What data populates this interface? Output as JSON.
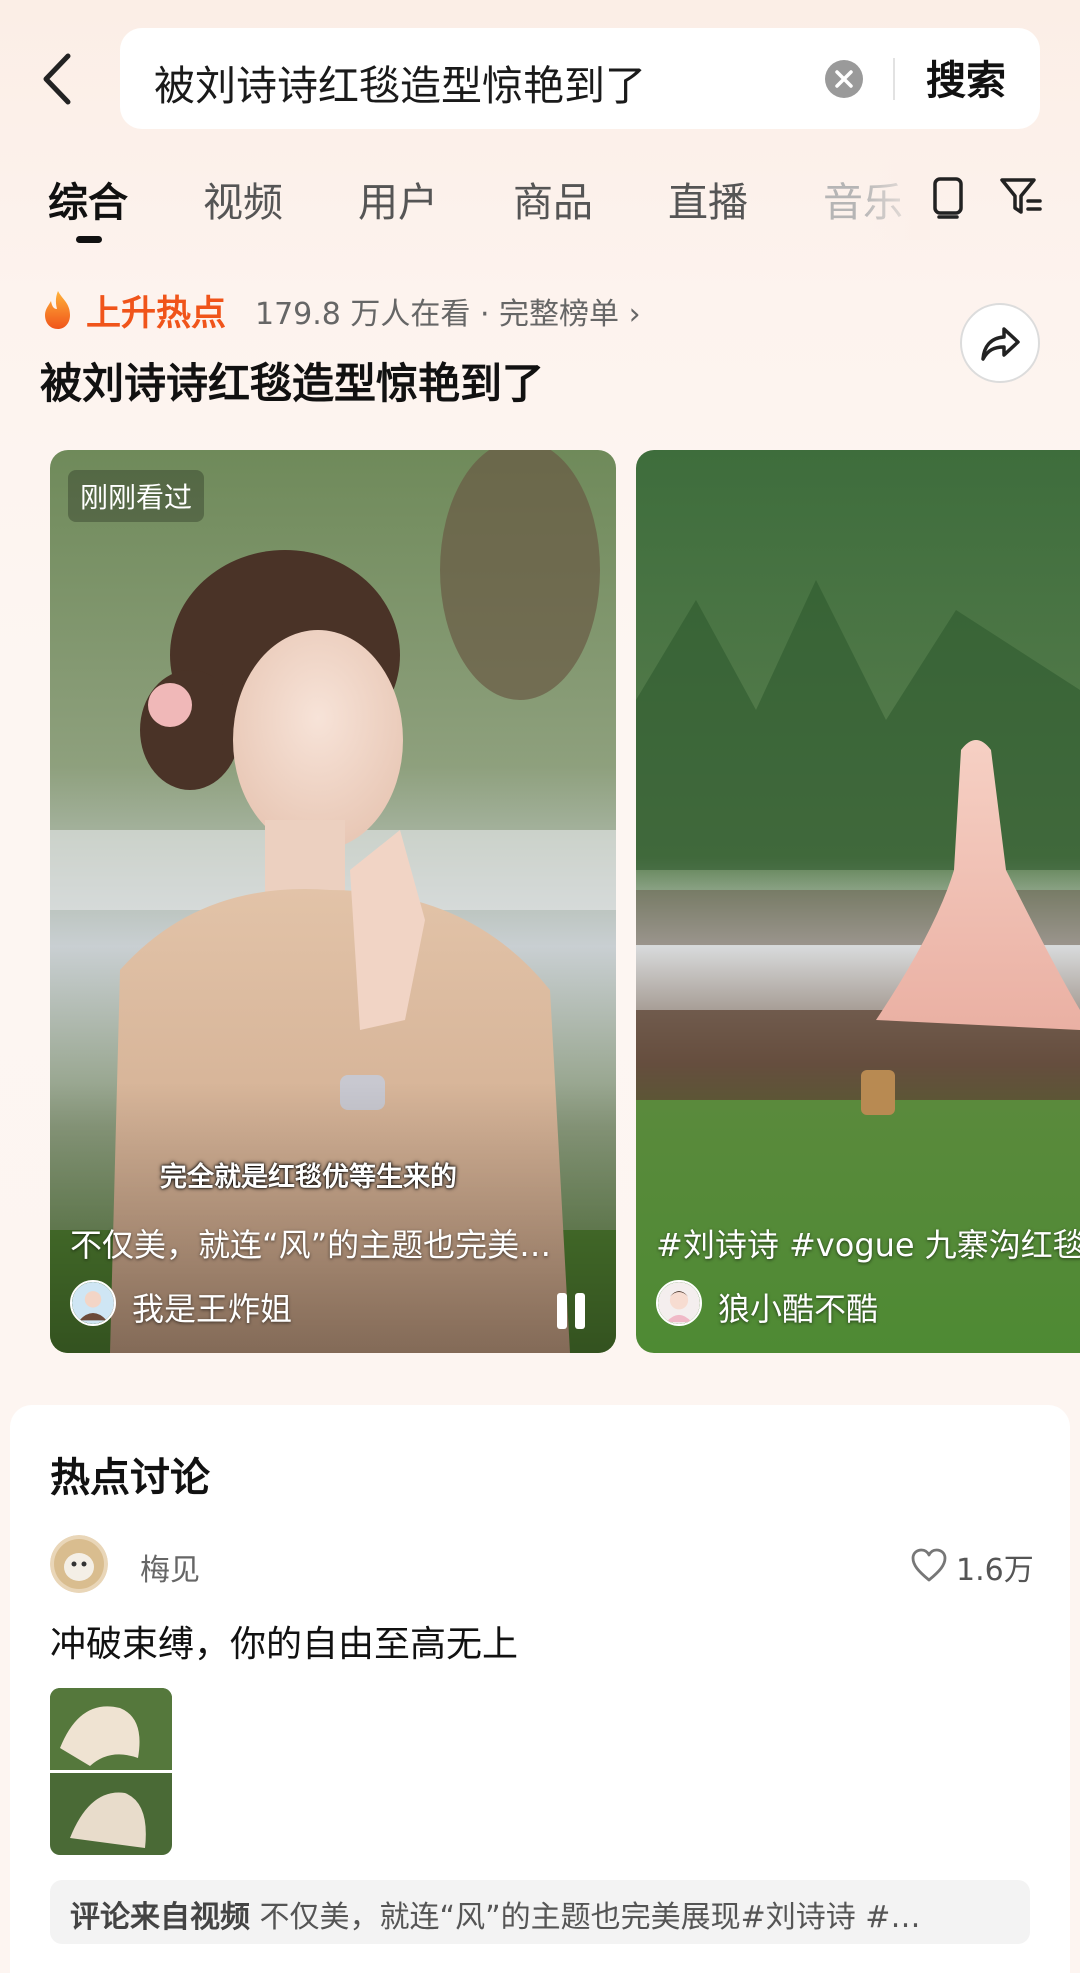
{
  "search": {
    "query": "被刘诗诗红毯造型惊艳到了",
    "submit_label": "搜索",
    "icons": {
      "back": "chevron-left-icon",
      "clear": "clear-x-icon"
    }
  },
  "tabs": [
    {
      "label": "综合",
      "active": true
    },
    {
      "label": "视频"
    },
    {
      "label": "用户"
    },
    {
      "label": "商品"
    },
    {
      "label": "直播"
    },
    {
      "label": "音乐"
    }
  ],
  "tab_icons": [
    "tablet-icon",
    "filter-icon"
  ],
  "hot_topic": {
    "badge": "上升热点",
    "meta": "179.8 万人在看 · 完整榜单 ›",
    "title": "被刘诗诗红毯造型惊艳到了",
    "badge_color": "#f0541a"
  },
  "videos": [
    {
      "badge": "刚刚看过",
      "subtitle": "完全就是红毯优等生来的",
      "caption": "不仅美，就连“风”的主题也完美…",
      "author": "我是王炸姐",
      "playing": true
    },
    {
      "caption": "#刘诗诗 #vogue 九寨沟红毯",
      "author": "狼小酷不酷"
    }
  ],
  "discussion": {
    "title": "热点讨论",
    "user": "梅见",
    "likes": "1.6万",
    "comment": "冲破束缚，你的自由至高无上",
    "source_label": "评论来自视频",
    "source_text": "不仅美，就连“风”的主题也完美展现#刘诗诗 #…"
  }
}
